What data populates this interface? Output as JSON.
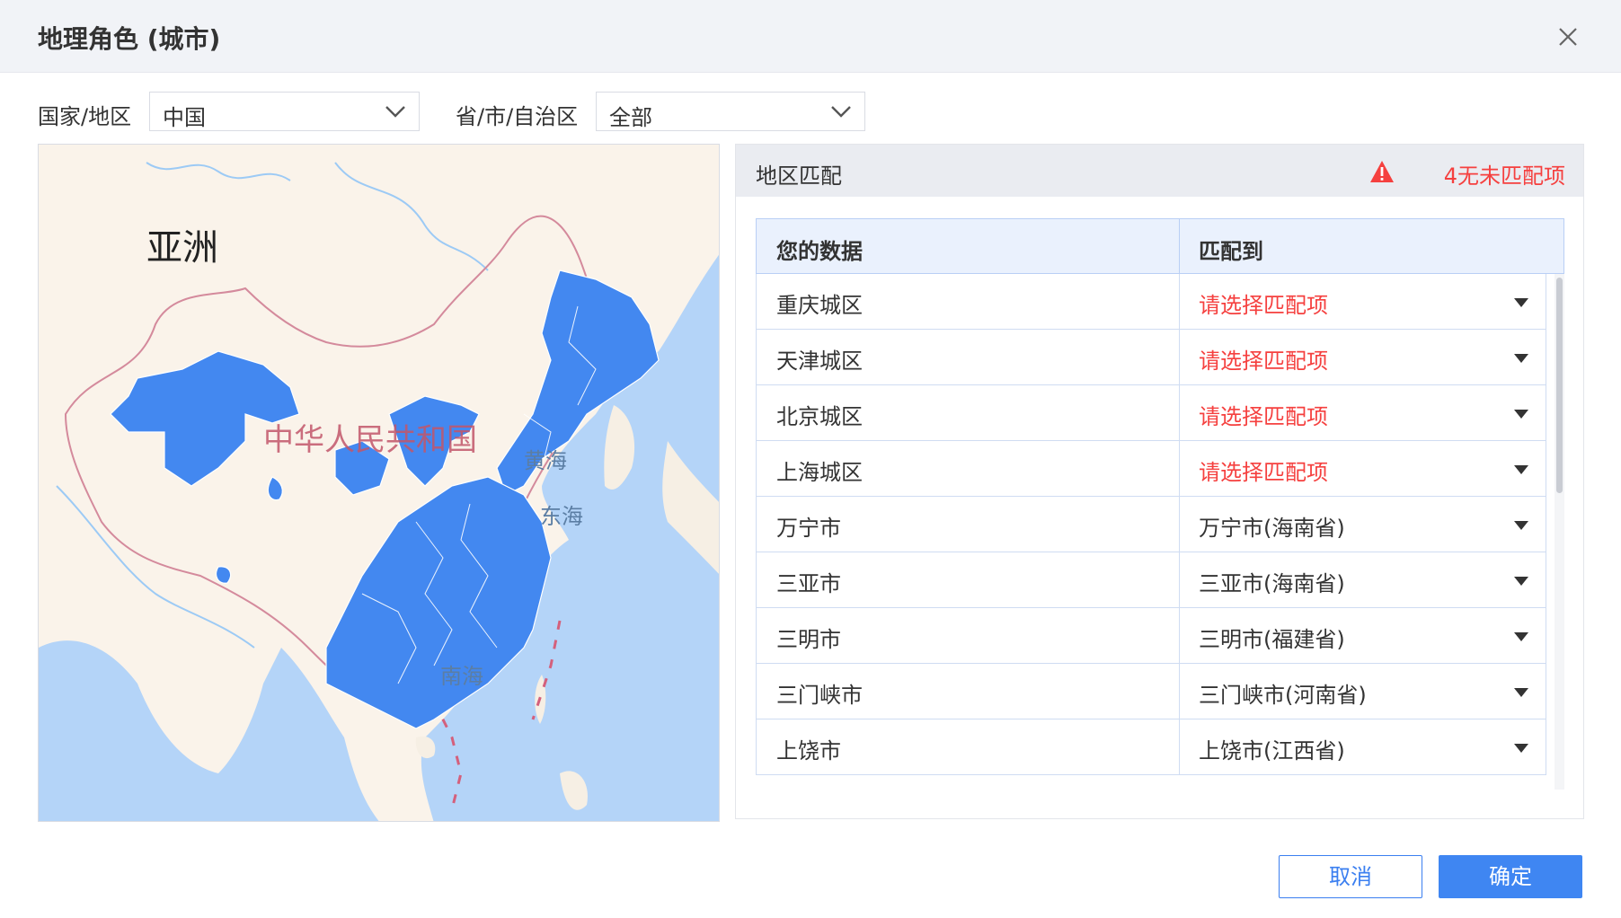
{
  "dialog": {
    "title": "地理角色 (城市)",
    "close_icon": "close-icon"
  },
  "filters": {
    "country_label": "国家/地区",
    "country_value": "中国",
    "province_label": "省/市/自治区",
    "province_value": "全部"
  },
  "map": {
    "continent_label": "亚洲",
    "country_label": "中华人民共和国",
    "sea_labels": [
      "黄海",
      "东海",
      "南海"
    ],
    "fill_color": "#4388f0"
  },
  "panel": {
    "title": "地区匹配",
    "warning_icon": "warning-icon",
    "warning_text": "4无未匹配项",
    "columns": [
      "您的数据",
      "匹配到"
    ],
    "rows": [
      {
        "name": "重庆城区",
        "match": "请选择匹配项",
        "unmatched": true
      },
      {
        "name": "天津城区",
        "match": "请选择匹配项",
        "unmatched": true
      },
      {
        "name": "北京城区",
        "match": "请选择匹配项",
        "unmatched": true
      },
      {
        "name": "上海城区",
        "match": "请选择匹配项",
        "unmatched": true
      },
      {
        "name": "万宁市",
        "match": "万宁市(海南省)",
        "unmatched": false
      },
      {
        "name": "三亚市",
        "match": "三亚市(海南省)",
        "unmatched": false
      },
      {
        "name": "三明市",
        "match": "三明市(福建省)",
        "unmatched": false
      },
      {
        "name": "三门峡市",
        "match": "三门峡市(河南省)",
        "unmatched": false
      },
      {
        "name": "上饶市",
        "match": "上饶市(江西省)",
        "unmatched": false
      }
    ]
  },
  "buttons": {
    "cancel": "取消",
    "confirm": "确定"
  },
  "colors": {
    "accent": "#3f86f2",
    "warning": "#f5403f",
    "header_bg": "#f1f3f7"
  }
}
